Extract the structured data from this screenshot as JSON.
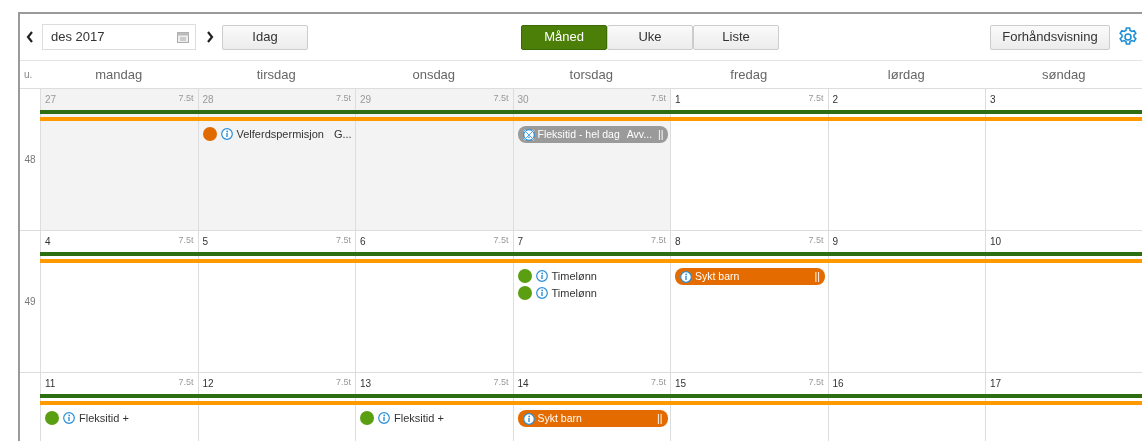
{
  "toolbar": {
    "period": "des 2017",
    "today_button": "Idag",
    "views": [
      {
        "label": "Måned",
        "selected": true
      },
      {
        "label": "Uke",
        "selected": false
      },
      {
        "label": "Liste",
        "selected": false
      }
    ],
    "preview_button": "Forhåndsvisning"
  },
  "calendar": {
    "week_heading": "u.",
    "weekdays": [
      "mandag",
      "tirsdag",
      "onsdag",
      "torsdag",
      "fredag",
      "lørdag",
      "søndag"
    ],
    "weeks": [
      {
        "number": "48",
        "bands": [
          {
            "color": "#2e6e12"
          },
          {
            "color": "#ff9900"
          }
        ],
        "days": [
          {
            "day": "27",
            "hours": "7.5t",
            "outside_month": true
          },
          {
            "day": "28",
            "hours": "7.5t",
            "outside_month": true,
            "events": [
              {
                "kind": "dot",
                "color": "#e06a00",
                "label": "Velferdspermisjon",
                "detail": "G..."
              }
            ]
          },
          {
            "day": "29",
            "hours": "7.5t",
            "outside_month": true
          },
          {
            "day": "30",
            "hours": "7.5t",
            "outside_month": true,
            "events": [
              {
                "kind": "pill",
                "color": "#9a9a9a",
                "crossed_out": true,
                "label": "Fleksitid - hel dag",
                "detail": "Avv...",
                "handle": "||"
              }
            ]
          },
          {
            "day": "1",
            "hours": "7.5t",
            "outside_month": false
          },
          {
            "day": "2",
            "outside_month": false
          },
          {
            "day": "3",
            "outside_month": false
          }
        ]
      },
      {
        "number": "49",
        "bands": [
          {
            "color": "#2e6e12"
          },
          {
            "color": "#ff9900"
          }
        ],
        "days": [
          {
            "day": "4",
            "hours": "7.5t",
            "outside_month": false
          },
          {
            "day": "5",
            "hours": "7.5t",
            "outside_month": false
          },
          {
            "day": "6",
            "hours": "7.5t",
            "outside_month": false
          },
          {
            "day": "7",
            "hours": "7.5t",
            "outside_month": false,
            "events": [
              {
                "kind": "dot",
                "color": "#5a9e12",
                "label": "Timelønn"
              },
              {
                "kind": "dot",
                "color": "#5a9e12",
                "label": "Timelønn"
              }
            ]
          },
          {
            "day": "8",
            "hours": "7.5t",
            "outside_month": false,
            "events": [
              {
                "kind": "pill",
                "color": "#e46b00",
                "crossed_out": false,
                "label": "Sykt barn",
                "handle": "||"
              }
            ]
          },
          {
            "day": "9",
            "outside_month": false
          },
          {
            "day": "10",
            "outside_month": false
          }
        ]
      },
      {
        "bands": [
          {
            "color": "#2e6e12"
          },
          {
            "color": "#ff9900"
          }
        ],
        "days": [
          {
            "day": "11",
            "hours": "7.5t",
            "outside_month": false,
            "events": [
              {
                "kind": "dot",
                "color": "#5a9e12",
                "label": "Fleksitid +"
              }
            ]
          },
          {
            "day": "12",
            "hours": "7.5t",
            "outside_month": false
          },
          {
            "day": "13",
            "hours": "7.5t",
            "outside_month": false,
            "events": [
              {
                "kind": "dot",
                "color": "#5a9e12",
                "label": "Fleksitid +"
              }
            ]
          },
          {
            "day": "14",
            "hours": "7.5t",
            "outside_month": false,
            "events": [
              {
                "kind": "pill",
                "color": "#e46b00",
                "crossed_out": false,
                "label": "Sykt barn",
                "handle": "||"
              }
            ]
          },
          {
            "day": "15",
            "hours": "7.5t",
            "outside_month": false
          },
          {
            "day": "16",
            "outside_month": false
          },
          {
            "day": "17",
            "outside_month": false
          }
        ]
      }
    ]
  }
}
